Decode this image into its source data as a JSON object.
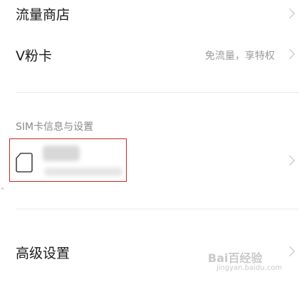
{
  "menu": {
    "traffic_store": {
      "label": "流量商店"
    },
    "vfan_card": {
      "label": "V粉卡",
      "subtitle": "免流量，享特权"
    },
    "advanced": {
      "label": "高级设置"
    }
  },
  "sim_section": {
    "header": "SIM卡信息与设置"
  },
  "watermark": {
    "brand": "Bai百经验",
    "url": "jingyan.baidu.com"
  },
  "colors": {
    "highlight_box": "#c62828",
    "chevron": "#bdbdbd",
    "secondary_text": "#9a9a9a"
  }
}
